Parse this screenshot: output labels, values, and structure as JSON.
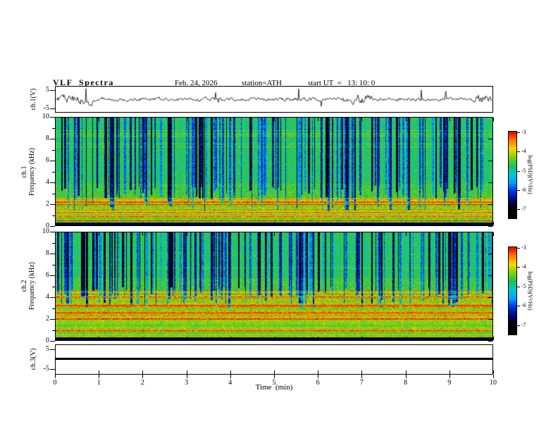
{
  "header": {
    "title": "VLF  Spectra",
    "date": "Feb. 24, 2026",
    "station": "station=ATH",
    "start_ut": "start UT  =   13: 10: 0"
  },
  "xaxis": {
    "label": "Time  (min)",
    "min": 0,
    "max": 10,
    "ticks": [
      "0",
      "1",
      "2",
      "3",
      "4",
      "5",
      "6",
      "7",
      "8",
      "9",
      "10"
    ]
  },
  "panels": {
    "wave1": {
      "label": "ch.1(V)",
      "yticks": [
        "5",
        "-5"
      ]
    },
    "spec1": {
      "label_channel": "ch.1",
      "label_axis": "Frequency (kHz)",
      "yticks": [
        "0",
        "2",
        "4",
        "6",
        "8",
        "10"
      ],
      "ymin": 0,
      "ymax": 10
    },
    "spec2": {
      "label_channel": "ch.2",
      "label_axis": "Frequency (kHz)",
      "yticks": [
        "0",
        "2",
        "4",
        "6",
        "8",
        "10"
      ],
      "ymin": 0,
      "ymax": 10
    },
    "wave3": {
      "label": "ch.3(V)",
      "yticks": [
        "5",
        "-5"
      ]
    }
  },
  "colorbar": {
    "label": "log(PSD)(V²/Hz)",
    "ticks": [
      "-3",
      "-4",
      "-5",
      "-6",
      "-7"
    ],
    "min": -7,
    "max": -3,
    "stops_low_to_high": [
      "#000000",
      "#000a80",
      "#0033dd",
      "#00a2ff",
      "#00c8c8",
      "#1fbf5f",
      "#7fd400",
      "#ffd400",
      "#ff7800",
      "#dd0000"
    ]
  },
  "chart_data": [
    {
      "type": "line",
      "title": "ch.1 voltage waveform",
      "xlabel": "Time (min)",
      "x_range": [
        0,
        10
      ],
      "ylabel": "ch.1(V)",
      "y_range": [
        -5,
        5
      ],
      "yticks": [
        -5,
        5
      ],
      "series": [
        {
          "name": "ch.1",
          "description": "broadband noise centered on 0 V, typical excursions ±1–2 V with frequent impulsive spikes up to about ±4 V across the full 10 minute record"
        }
      ],
      "grid": false
    },
    {
      "type": "heatmap",
      "title": "ch.1 VLF spectrogram",
      "xlabel": "Time (min)",
      "x_range": [
        0,
        10
      ],
      "ylabel": "ch.1 Frequency (kHz)",
      "y_range": [
        0,
        10
      ],
      "yticks": [
        0,
        2,
        4,
        6,
        8,
        10
      ],
      "z_label": "log(PSD)(V²/Hz)",
      "z_range": [
        -7,
        -3
      ],
      "features": [
        "background PSD about -5 to -4.5 (green/cyan) from 3 to 10 kHz",
        "dense vertical sferic streaks with PSD about -6.5 to -7 (blue/black) extending from 10 kHz down to roughly 2-4 kHz",
        "horizontal enhanced bands PSD about -4 to -3.5 (yellow/orange/red) below roughly 2.5 kHz",
        "near-DC band below about 0.3 kHz at PSD about -7 (black)"
      ]
    },
    {
      "type": "heatmap",
      "title": "ch.2 VLF spectrogram",
      "xlabel": "Time (min)",
      "x_range": [
        0,
        10
      ],
      "ylabel": "ch.2 Frequency (kHz)",
      "y_range": [
        0,
        10
      ],
      "yticks": [
        0,
        2,
        4,
        6,
        8,
        10
      ],
      "z_label": "log(PSD)(V²/Hz)",
      "z_range": [
        -7,
        -3
      ],
      "features": [
        "background PSD about -5 to -4.5 (green/cyan) from 5 to 10 kHz",
        "dense vertical sferic streaks about -6.5 to -7 (blue/black) above roughly 4 kHz",
        "many horizontal yellow/orange/red bands about -4 to -3.5 below roughly 4.5 kHz",
        "near-DC band below about 0.3 kHz at PSD about -7 (black)"
      ]
    },
    {
      "type": "line",
      "title": "ch.3 voltage waveform",
      "xlabel": "Time (min)",
      "x_range": [
        0,
        10
      ],
      "ylabel": "ch.3(V)",
      "y_range": [
        -5,
        5
      ],
      "yticks": [
        -5,
        5
      ],
      "series": [
        {
          "name": "ch.3",
          "values_constant": 0,
          "description": "flat line at 0 V for the entire record (no signal)"
        }
      ],
      "grid": false
    }
  ],
  "render": {
    "seed_wave": 7,
    "seed_spec1": 101,
    "seed_spec2": 202,
    "spec1": {
      "bandTop": 2.7,
      "bandProb": 0.5,
      "bandGain": 0.3,
      "noise": 0.16,
      "streaks": 170,
      "baseHigh": 0.55,
      "baseLow": 0.63,
      "fbotMin": 1.3,
      "fbotRange": 2.4,
      "strongLines": [
        0.8,
        2.1
      ]
    },
    "spec2": {
      "bandTop": 4.6,
      "bandProb": 0.55,
      "bandGain": 0.33,
      "noise": 0.16,
      "streaks": 170,
      "baseHigh": 0.55,
      "baseLow": 0.64,
      "fbotMin": 3.0,
      "fbotRange": 2.0,
      "strongLines": [
        0.9,
        2.0,
        3.1,
        4.0
      ]
    }
  }
}
